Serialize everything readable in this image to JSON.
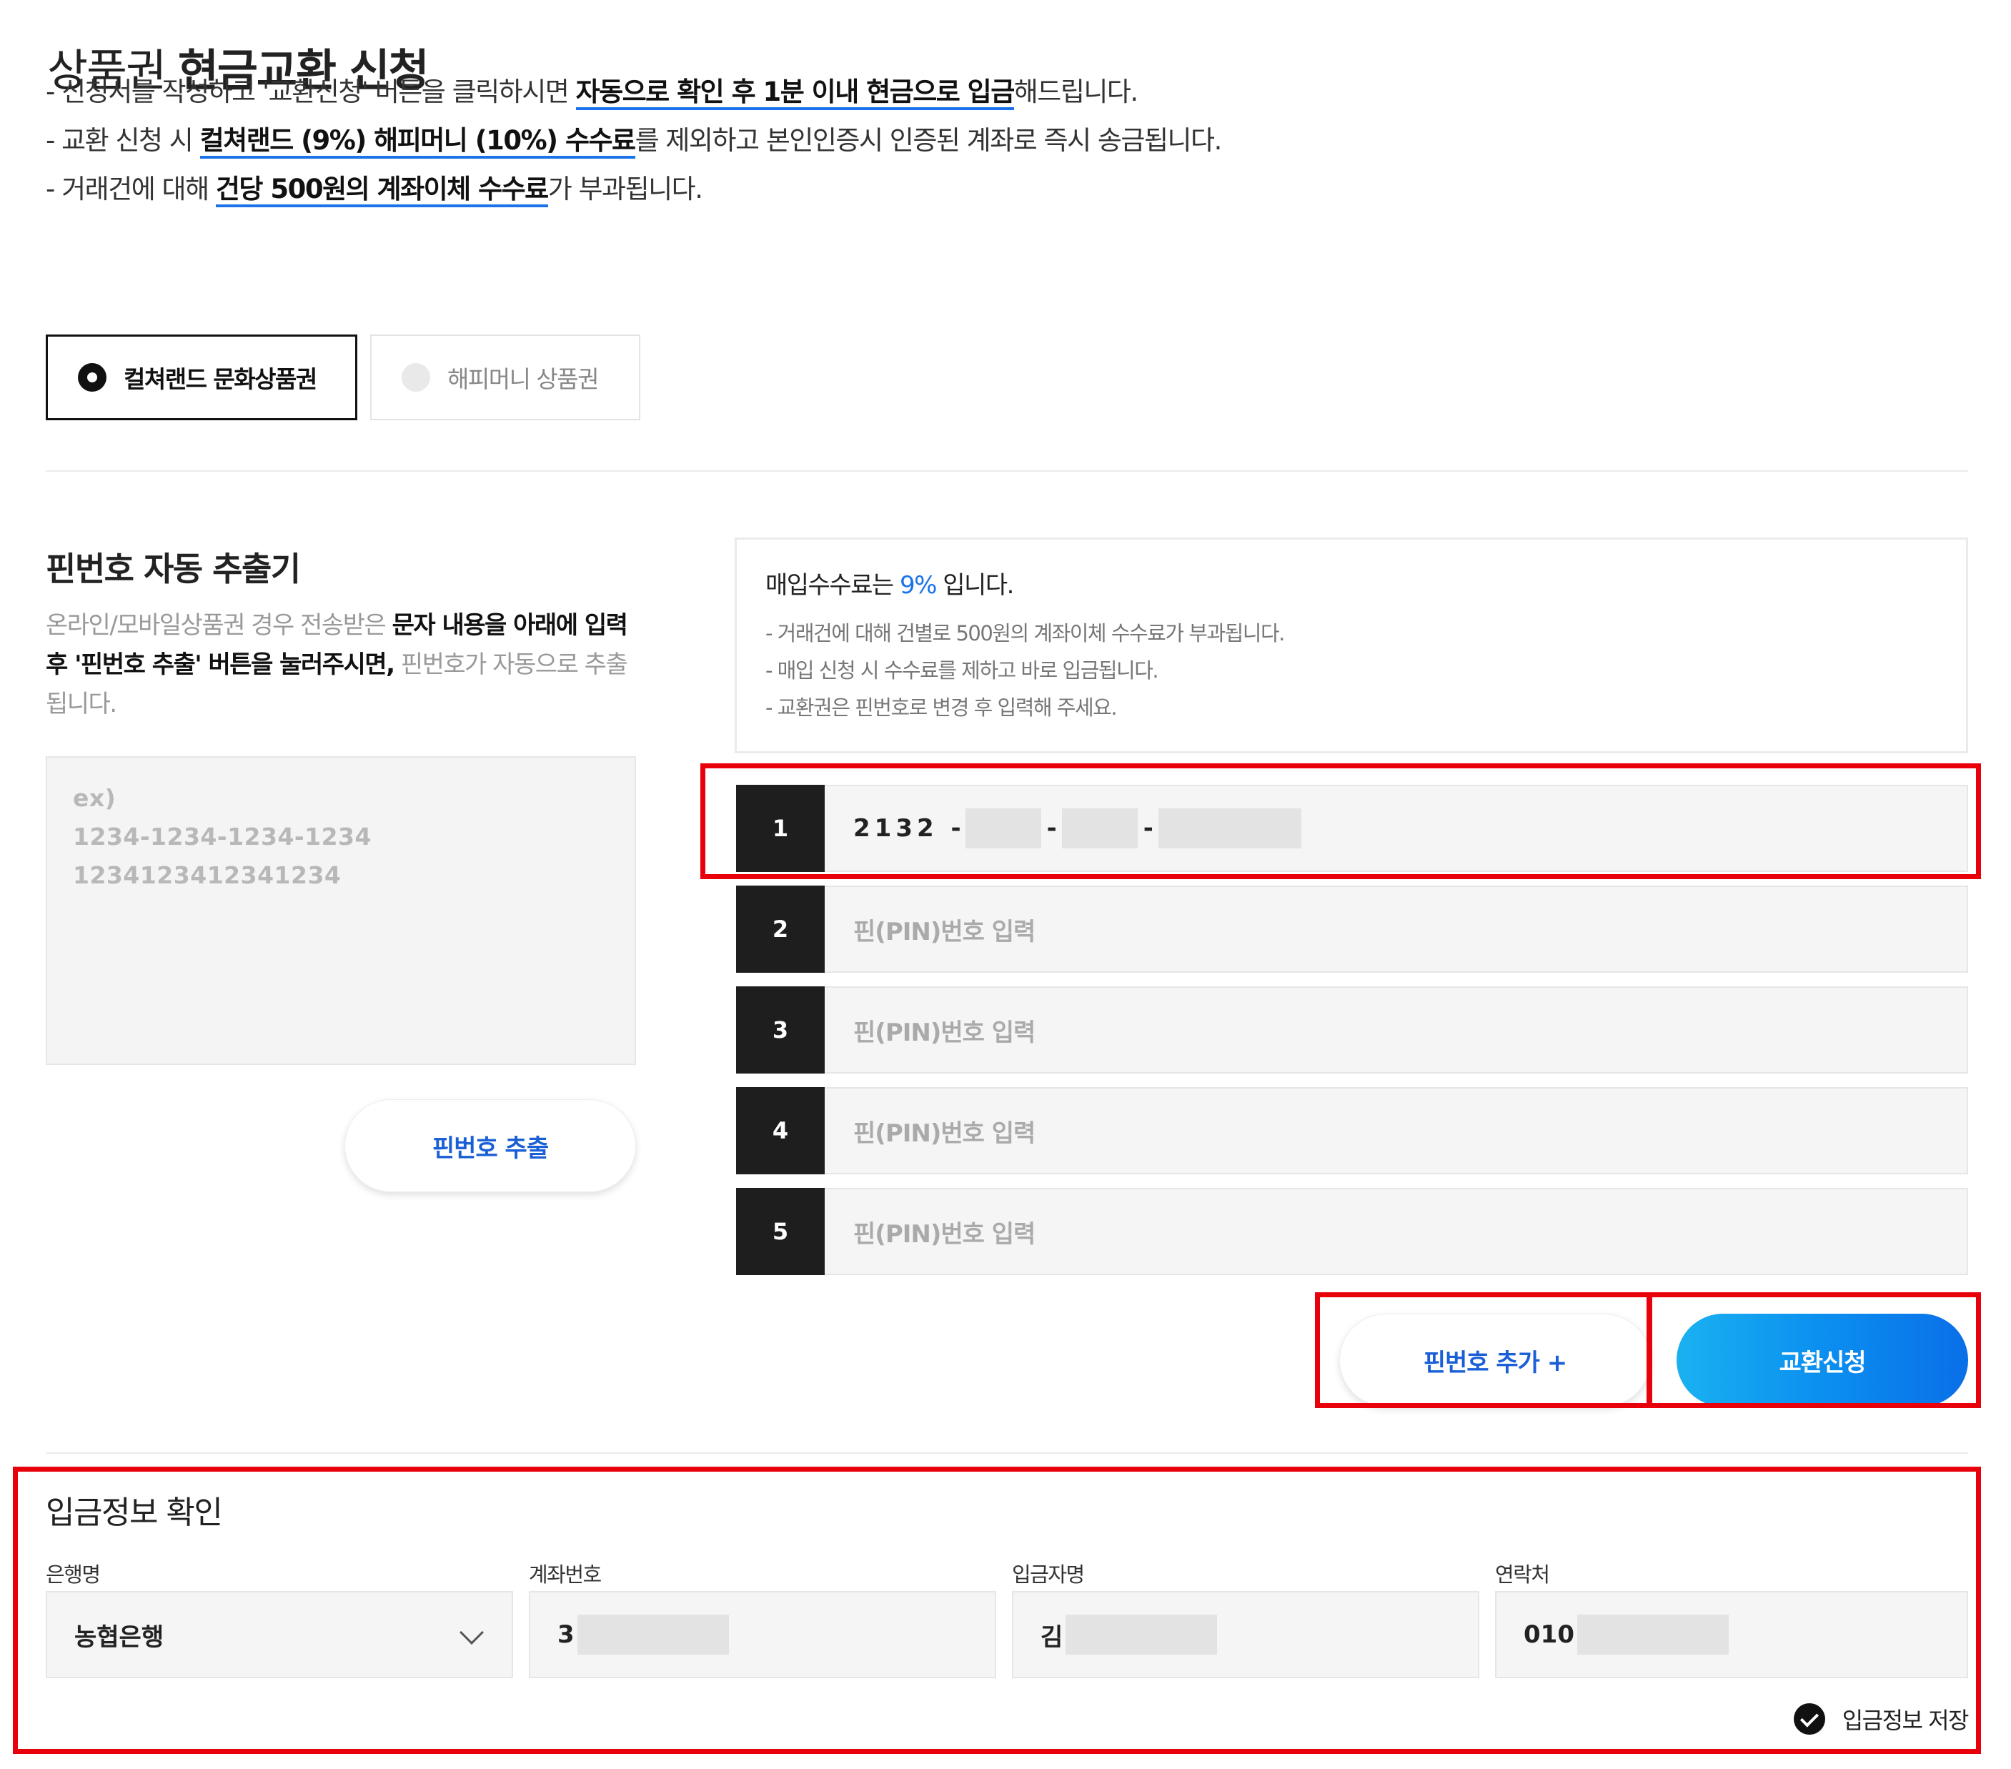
{
  "header": {
    "title_prefix": "상품권",
    "title_bold": "현금교환 신청"
  },
  "notices": [
    {
      "pre": "- 신청서를 작성하고 '교환신청' 버튼을 클릭하시면 ",
      "hl": "자동으로 확인 후 1분 이내 현금으로 입금",
      "post": "해드립니다."
    },
    {
      "pre": "- 교환 신청 시 ",
      "hl": "컬쳐랜드 (9%) 해피머니 (10%) 수수료",
      "post": "를 제외하고 본인인증시 인증된 계좌로 즉시 송금됩니다."
    },
    {
      "pre": "- 거래건에 대해 ",
      "hl": "건당 500원의 계좌이체 수수료",
      "post": "가 부과됩니다."
    }
  ],
  "voucher_types": [
    {
      "label": "컬쳐랜드 문화상품권",
      "selected": true
    },
    {
      "label": "해피머니 상품권",
      "selected": false
    }
  ],
  "extractor": {
    "title": "핀번호 자동 추출기",
    "desc_1": "온라인/모바일상품권 경우 전송받은 ",
    "desc_2": "문자 내용을 아래에 입력 후 '핀번호 추출' 버튼을 눌러주시면,",
    "desc_3": " 핀번호가 자동으로 추출됩니다.",
    "placeholder_lines": [
      "ex)",
      "1234-1234-1234-1234",
      "1234123412341234"
    ],
    "button": "핀번호 추출"
  },
  "fee": {
    "title_pre": "매입수수료는 ",
    "rate": "9%",
    "title_post": " 입니다.",
    "notes": [
      "- 거래건에 대해 건별로 500원의 계좌이체 수수료가 부과됩니다.",
      "- 매입 신청 시 수수료를 제하고 바로 입금됩니다.",
      "- 교환권은 핀번호로 변경 후 입력해 주세요."
    ]
  },
  "pins": [
    {
      "num": "1",
      "value_prefix": "2132 -"
    },
    {
      "num": "2",
      "placeholder": "핀(PIN)번호 입력"
    },
    {
      "num": "3",
      "placeholder": "핀(PIN)번호 입력"
    },
    {
      "num": "4",
      "placeholder": "핀(PIN)번호 입력"
    },
    {
      "num": "5",
      "placeholder": "핀(PIN)번호 입력"
    }
  ],
  "actions": {
    "add_pin": "핀번호 추가 +",
    "submit": "교환신청"
  },
  "deposit": {
    "title": "입금정보 확인",
    "bank_label": "은행명",
    "bank_value": "농협은행",
    "account_label": "계좌번호",
    "account_prefix": "3",
    "depositor_label": "입금자명",
    "depositor_prefix": "김",
    "contact_label": "연락처",
    "contact_prefix": "010",
    "save_label": "입금정보 저장"
  },
  "colors": {
    "accent": "#1a73e8",
    "highlight_border": "#e8000b",
    "submit_gradient_start": "#1ab1f0",
    "submit_gradient_end": "#0a6fe8"
  }
}
